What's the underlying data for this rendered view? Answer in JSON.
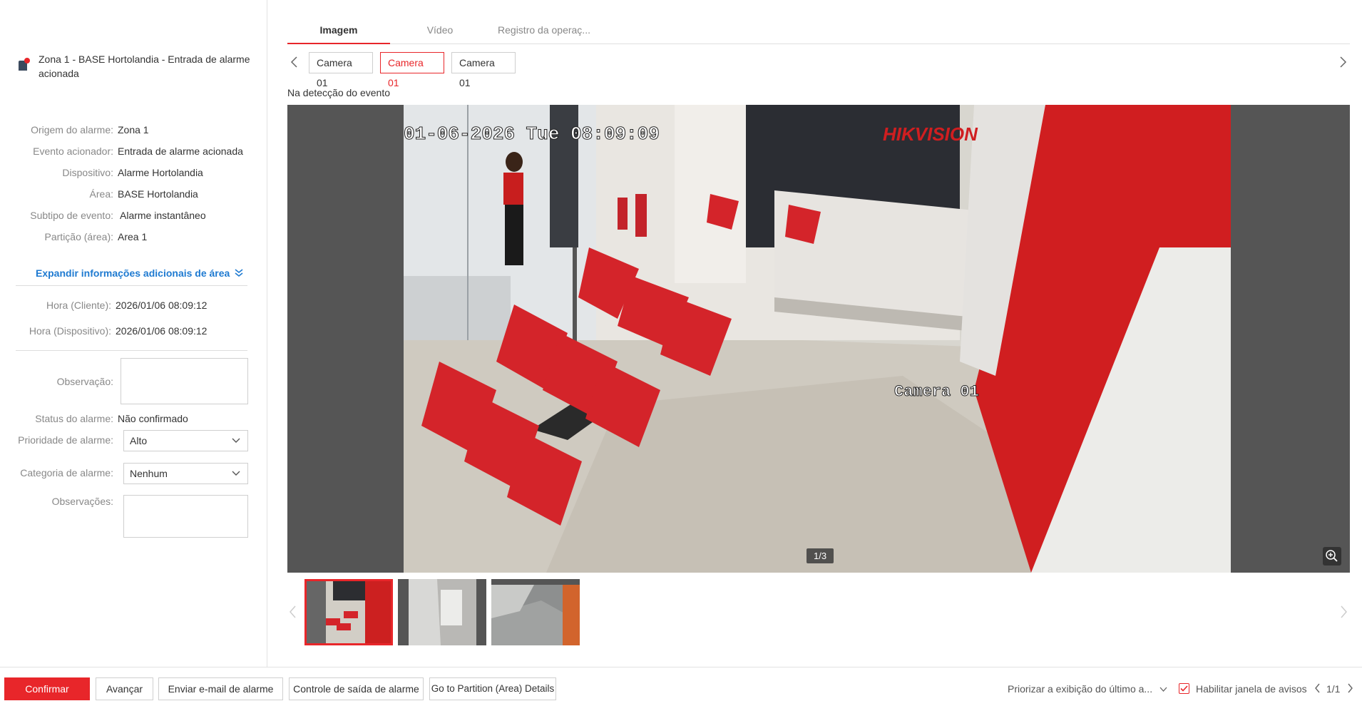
{
  "alarm": {
    "title": "Zona 1 - BASE Hortolandia - Entrada de alarme acionada",
    "title_line1": "Zona 1 - BASE Hortolandia - Entrada de alarme",
    "title_line2": "acionada",
    "icon": "alarm-input-icon"
  },
  "details": [
    {
      "label": "Origem do alarme:",
      "value": "Zona 1"
    },
    {
      "label": "Evento acionador:",
      "value": "Entrada de alarme acionada"
    },
    {
      "label": "Dispositivo:",
      "value": "Alarme Hortolandia"
    },
    {
      "label": "Área:",
      "value": "BASE Hortolandia"
    },
    {
      "label": "Subtipo de evento:",
      "value": "Alarme instantâneo"
    },
    {
      "label": "Partição (área):",
      "value": "Area 1"
    }
  ],
  "expand_label": "Expandir informações adicionais de área",
  "times": [
    {
      "label": "Hora (Cliente):",
      "value": "2026/01/06 08:09:12"
    },
    {
      "label": "Hora (Dispositivo):",
      "value": "2026/01/06 08:09:12"
    }
  ],
  "form": {
    "observacao_label": "Observação:",
    "status_label": "Status do alarme:",
    "status_value": "Não confirmado",
    "priority_label": "Prioridade de alarme:",
    "priority_value": "Alto",
    "category_label": "Categoria de alarme:",
    "category_value": "Nenhum",
    "observacoes_label": "Observações:"
  },
  "tabs": [
    "Imagem",
    "Vídeo",
    "Registro da operaç..."
  ],
  "cameras": [
    "Camera 01",
    "Camera 01",
    "Camera 01"
  ],
  "detect_label": "Na detecção do evento",
  "image": {
    "osd_datetime": "01-06-2026 Tue 08:09:09",
    "osd_camera": "Camera 01",
    "osd_brand": "HIKVISION",
    "counter": "1/3"
  },
  "footer": {
    "confirm": "Confirmar",
    "next": "Avançar",
    "email": "Enviar e-mail de alarme",
    "output": "Controle de saída de alarme",
    "partition": "Go to Partition (Area) Details",
    "priority_display": "Priorizar a exibição do último a...",
    "enable_popup": "Habilitar janela de avisos",
    "page": "1/1"
  },
  "colors": {
    "accent": "#e8262a",
    "link": "#1e7ad1"
  }
}
